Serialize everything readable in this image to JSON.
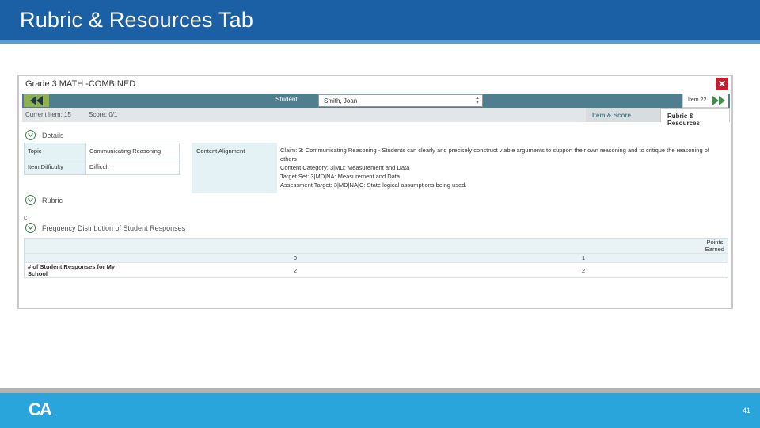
{
  "slide": {
    "title": "Rubric & Resources Tab",
    "page_number": "41",
    "logo_text": "CA"
  },
  "window": {
    "title": "Grade 3 MATH -COMBINED",
    "close_icon": "close-icon"
  },
  "nav": {
    "student_label": "Student:",
    "student_value": "Smith, Joan",
    "item_label": "Item 22"
  },
  "subbar": {
    "current_item": "Current Item: 15",
    "score": "Score: 0/1",
    "tabs": [
      {
        "label": "Item & Score"
      },
      {
        "label": "Rubric & Resources"
      }
    ]
  },
  "details": {
    "header": "Details",
    "rows": [
      {
        "label": "Topic",
        "value": "Communicating Reasoning"
      },
      {
        "label": "Item Difficulty",
        "value": "Difficult"
      }
    ],
    "content_alignment_label": "Content Alignment",
    "claim_lines": [
      "Claim: 3: Communicating Reasoning - Students can clearly and precisely construct viable arguments to support their own reasoning and to critique the reasoning of",
      "others",
      "Content Category: 3|MD: Measurement and Data",
      "Target Set: 3|MD|NA: Measurement and Data",
      "Assessment Target: 3|MD|NA|C: State logical assumptions being used."
    ]
  },
  "rubric": {
    "header": "Rubric",
    "marker": "C"
  },
  "frequency": {
    "header": "Frequency Distribution of Student Responses",
    "points_earned_label": "Points Earned",
    "points": [
      "0",
      "1"
    ],
    "row_label": "# of Student Responses for My School",
    "counts": [
      "2",
      "2"
    ]
  },
  "colors": {
    "header_bg": "#1b5fa5",
    "footer_bg": "#2aa5db",
    "nav_bg": "#4f7f8f",
    "nav_arrow": "#8fb04f",
    "close_bg": "#c0202e"
  }
}
